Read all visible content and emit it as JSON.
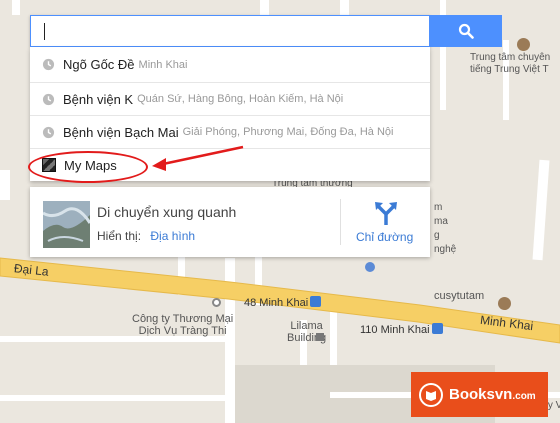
{
  "search": {
    "value": "",
    "placeholder": ""
  },
  "suggestions": [
    {
      "main": "Ngõ Gốc Đề",
      "sub": "Minh Khai",
      "icon": "clock-icon"
    },
    {
      "main": "Bệnh viện K",
      "sub": "Quán Sứ, Hàng Bông, Hoàn Kiếm, Hà Nội",
      "icon": "clock-icon"
    },
    {
      "main": "Bệnh viện Bạch Mai",
      "sub": "Giải Phóng, Phương Mai, Đống Đa, Hà Nội",
      "icon": "clock-icon"
    },
    {
      "main": "My Maps",
      "sub": "",
      "icon": "my-maps-icon"
    }
  ],
  "explore": {
    "title": "Di chuyển xung quanh",
    "view_label": "Hiển thị:",
    "view_link": "Địa hình",
    "directions_label": "Chỉ đường"
  },
  "map_labels": {
    "school_name_line1": "Trung tâm chuyên",
    "school_name_line2": "tiếng Trung Việt T",
    "road_dai_la": "Đại La",
    "bus_48": "48 Minh Khai",
    "bus_110": "110 Minh Khai",
    "road_minh_khai": "Minh Khai",
    "company_line1": "Công ty Thương Mại",
    "company_line2": "Dịch Vụ Tràng Thi",
    "lilama_line1": "Lilama",
    "lilama_line2": "Building",
    "cusytutam": "cusytutam",
    "partial_left": "Trung tâm thương",
    "partial_ma": "ma",
    "partial_g": "g",
    "partial_nghe": "nghệ",
    "partial_mt": "m",
    "partial_bottom_right": "mây Việt"
  },
  "watermark": {
    "brand": "Booksvn",
    "suffix": ".com"
  },
  "colors": {
    "accent": "#4d90fe",
    "link": "#3b7bd5",
    "annotation": "#e21b1b",
    "watermark": "#e94e1b",
    "road_major": "#f6cf65",
    "map_bg": "#ebe7df"
  }
}
